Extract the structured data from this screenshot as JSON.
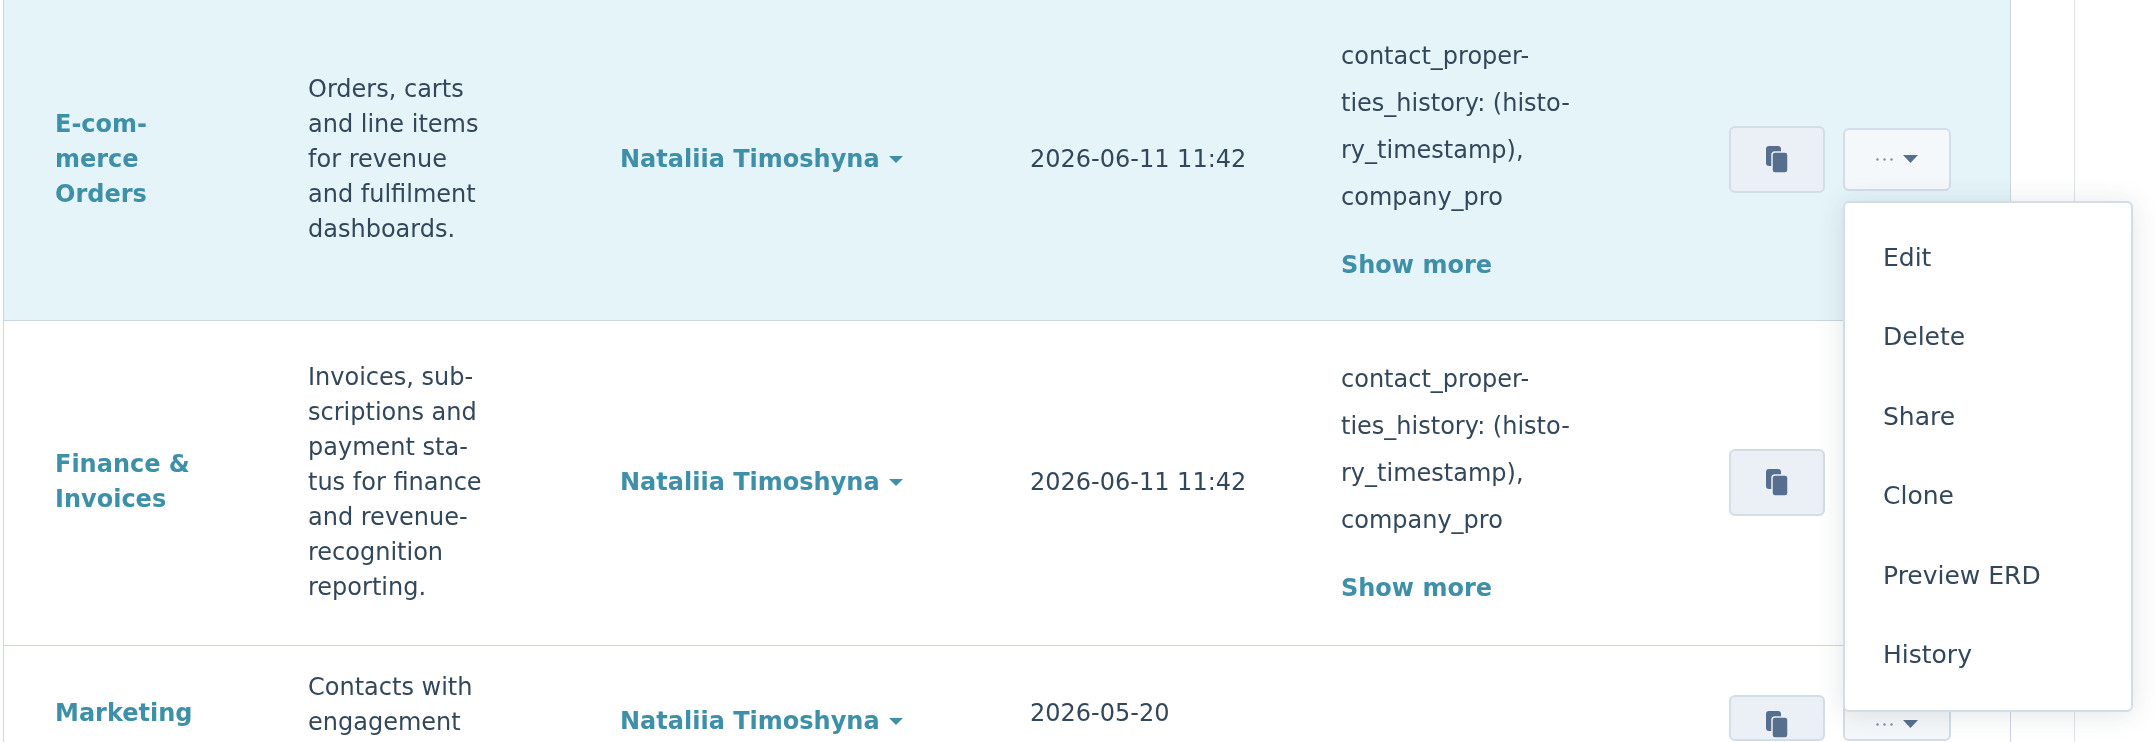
{
  "rows": [
    {
      "selected": true,
      "name": "E-com-\nmerce\nOrders",
      "description": "Orders, carts\nand line items\nfor revenue\nand fulfilment\ndashboards.",
      "owner": "Nataliia Timoshyna",
      "date": "2026-06-11 11:42",
      "properties": "contact_proper-\nties_history: (histo-\nry_timestamp),\ncompany_pro",
      "show_more": "Show more",
      "actions": [
        {
          "kind": "copy"
        },
        {
          "kind": "more"
        }
      ],
      "menu": {
        "items": [
          "Edit",
          "Delete",
          "Share",
          "Clone",
          "Preview ERD",
          "History"
        ]
      }
    },
    {
      "selected": false,
      "name": "Finance &\nInvoices",
      "description": "Invoices, sub-\nscriptions and\npayment sta-\ntus for finance\nand revenue-\nrecognition\nreporting.",
      "owner": "Nataliia Timoshyna",
      "date": "2026-06-11 11:42",
      "properties": "contact_proper-\nties_history: (histo-\nry_timestamp),\ncompany_pro",
      "show_more": "Show more",
      "actions": [
        {
          "kind": "copy"
        }
      ]
    },
    {
      "selected": false,
      "name": "Marketing",
      "description": "Contacts with\nengagement",
      "owner": "Nataliia Timoshyna",
      "date": "2026-05-20",
      "actions": [
        {
          "kind": "copy"
        },
        {
          "kind": "more"
        }
      ]
    }
  ]
}
